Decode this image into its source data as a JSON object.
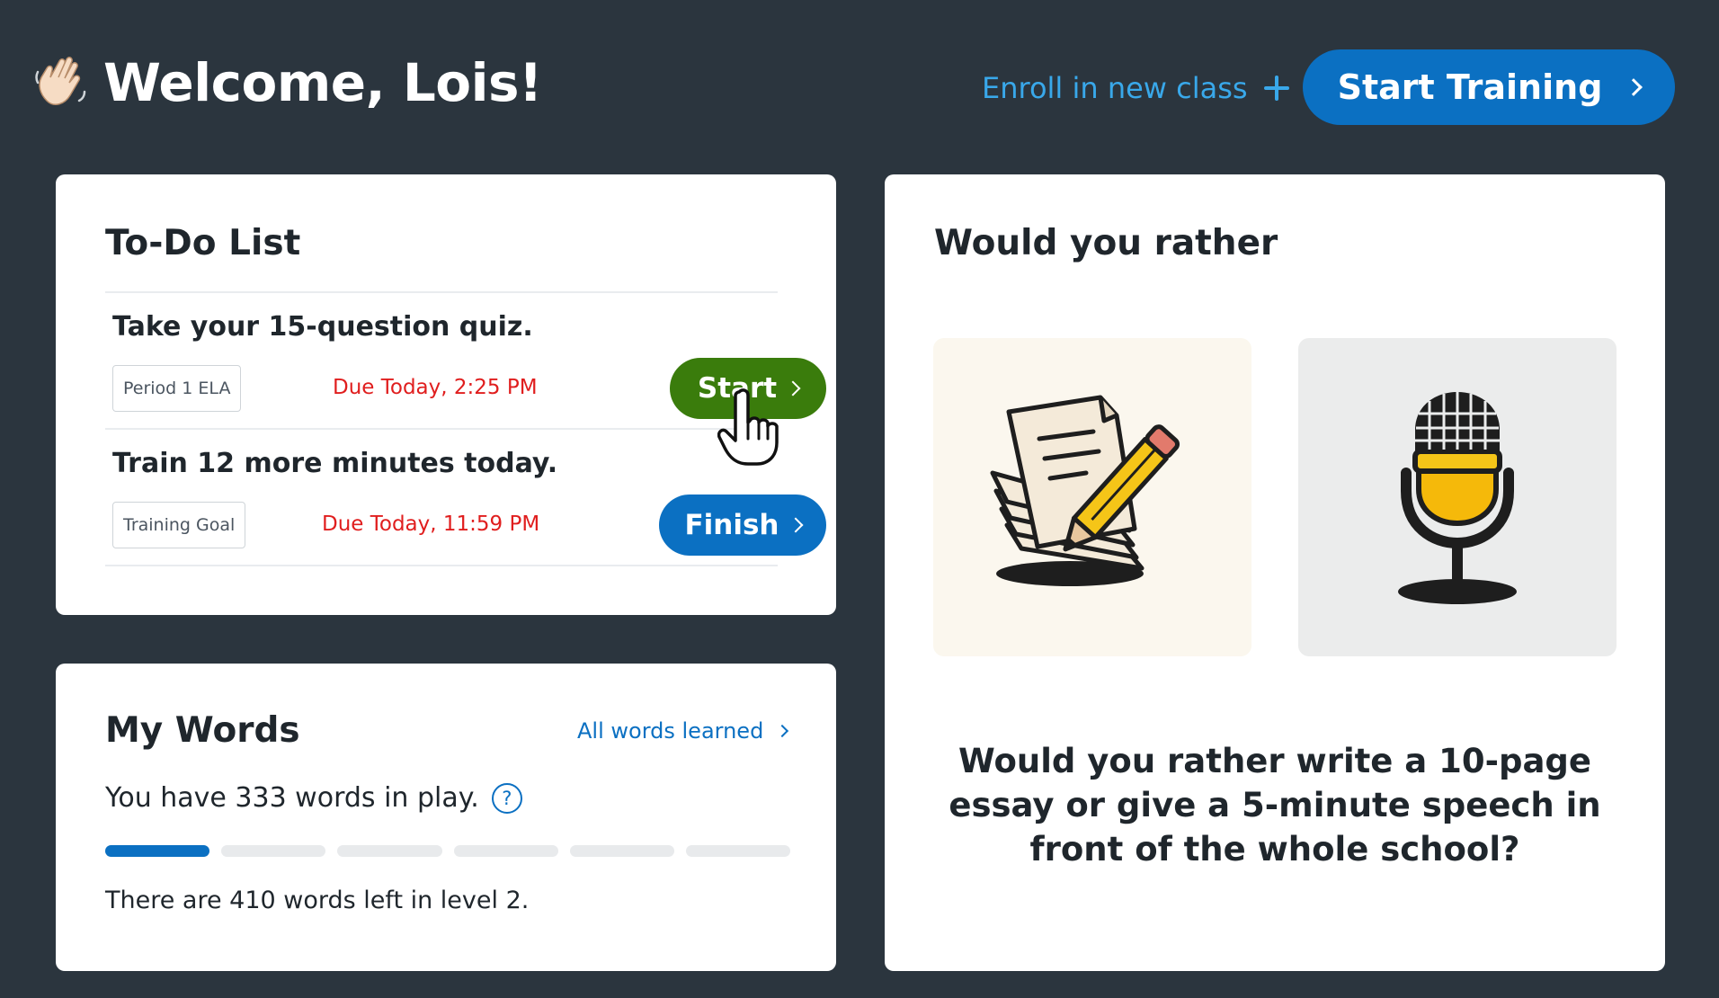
{
  "header": {
    "welcome": "Welcome, Lois!",
    "enroll_label": "Enroll in new class",
    "start_training_label": "Start Training"
  },
  "todo": {
    "title": "To-Do List",
    "items": [
      {
        "task": "Take your 15-question quiz.",
        "tag": "Period 1 ELA",
        "due": "Due Today, 2:25 PM",
        "button": "Start",
        "button_color": "#3a7c0c"
      },
      {
        "task": "Train 12 more minutes today.",
        "tag": "Training Goal",
        "due": "Due Today, 11:59 PM",
        "button": "Finish",
        "button_color": "#0b70c2"
      }
    ]
  },
  "words": {
    "title": "My Words",
    "all_learned_label": "All words learned",
    "in_play": "You have 333 words in play.",
    "help_glyph": "?",
    "progress": {
      "segments_total": 6,
      "segments_filled": 1
    },
    "left_text": "There are 410 words left in level 2."
  },
  "wyr": {
    "title": "Would you rather",
    "options": [
      {
        "icon": "essay-writing-icon"
      },
      {
        "icon": "microphone-icon"
      }
    ],
    "question": "Would you rather write a 10-page essay or give a 5-minute speech in front of the whole school?"
  },
  "colors": {
    "background": "#2b353e",
    "primary": "#0b70c2",
    "link": "#39a8ea",
    "success": "#3a7c0c",
    "due": "#e01e1e"
  }
}
